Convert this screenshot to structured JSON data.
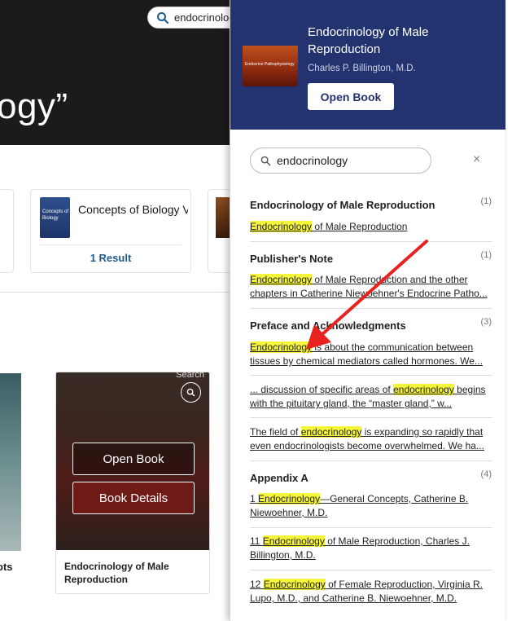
{
  "background": {
    "hero_title": "ogy”",
    "top_search_query": "endocrinology",
    "concepts_card": {
      "cover_text": "Concepts of Biology",
      "title": "Concepts of Biology VST Interactive Ope...",
      "results": "1 Result"
    },
    "book_card": {
      "search_label": "Search",
      "open_book": "Open Book",
      "book_details": "Book Details",
      "title": "Endocrinology of Male Reproduction"
    },
    "left_stub_text": "ots"
  },
  "panel": {
    "cover_text": "Endocrine Pathophysiology",
    "title": "Endocrinology of Male Reproduction",
    "author": "Charles P. Billington, M.D.",
    "open_book": "Open Book",
    "search_query": "endocrinology",
    "close": "×",
    "sections": [
      {
        "title": "Endocrinology of Male Reproduction",
        "count": "(1)",
        "results": [
          {
            "pre": "",
            "hl": "Endocrinology",
            "post": " of Male Reproduction"
          }
        ]
      },
      {
        "title": "Publisher's Note",
        "count": "(1)",
        "results": [
          {
            "pre": "",
            "hl": "Endocrinology",
            "post": " of Male Reproduction and the other chapters in Catherine Niewoehner's Endocrine Patho..."
          }
        ]
      },
      {
        "title": "Preface and Acknowledgments",
        "count": "(3)",
        "results": [
          {
            "pre": "",
            "hl": "Endocrinology",
            "post": " is about the communication between tissues by chemical mediators called hormones. We..."
          },
          {
            "pre": "... discussion of specific areas of ",
            "hl": "endocrinology",
            "post": " begins with the pituitary gland, the “master gland,” w..."
          },
          {
            "pre": "The field of ",
            "hl": "endocrinology",
            "post": " is expanding so rapidly that even endocrinologists become overwhelmed. We ha..."
          }
        ]
      },
      {
        "title": "Appendix A",
        "count": "(4)",
        "results": [
          {
            "pre": "1 ",
            "hl": "Endocrinology",
            "post": "—General Concepts, Catherine B. Niewoehner, M.D."
          },
          {
            "pre": "11 ",
            "hl": "Endocrinology",
            "post": " of Male Reproduction, Charles J. Billington, M.D."
          },
          {
            "pre": "12 ",
            "hl": "Endocrinology",
            "post": " of Female Reproduction, Virginia R. Lupo, M.D., and Catherine B. Niewoehner, M.D."
          }
        ]
      }
    ]
  },
  "colors": {
    "panel_header": "#23336f",
    "highlight": "#f5f53a",
    "annotation_arrow": "#e8231f",
    "link_blue": "#1d5c8d"
  }
}
